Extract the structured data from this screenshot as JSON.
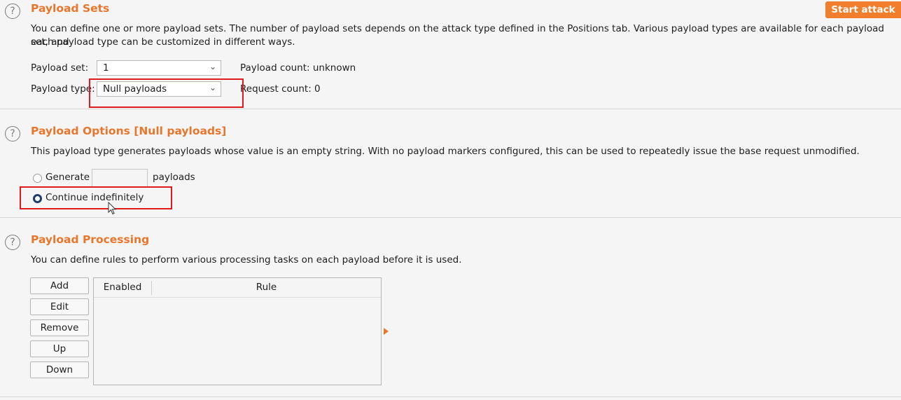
{
  "payload_sets": {
    "title": "Payload Sets",
    "start_attack": "Start attack",
    "desc_line1": "You can define one or more payload sets. The number of payload sets depends on the attack type defined in the Positions tab. Various payload types are available for each payload set, and",
    "desc_line2": "each payload type can be customized in different ways.",
    "set_label": "Payload set:",
    "set_value": "1",
    "type_label": "Payload type:",
    "type_value": "Null payloads",
    "payload_count": "Payload count: unknown",
    "request_count": "Request count: 0"
  },
  "payload_options": {
    "title": "Payload Options [Null payloads]",
    "desc": "This payload type generates payloads whose value is an empty string. With no payload markers configured, this can be used to repeatedly issue the base request unmodified.",
    "generate_label": "Generate",
    "generate_value": "",
    "payloads_suffix": "payloads",
    "continue_label": "Continue indefinitely",
    "selected_option": "continue"
  },
  "payload_processing": {
    "title": "Payload Processing",
    "desc": "You can define rules to perform various processing tasks on each payload before it is used.",
    "buttons": [
      "Add",
      "Edit",
      "Remove",
      "Up",
      "Down"
    ],
    "columns": [
      "Enabled",
      "Rule"
    ],
    "rows": []
  },
  "colors": {
    "accent": "#e8762c",
    "highlight": "#e01b1b"
  },
  "icons": [
    "help-icon",
    "chevron-down-icon",
    "mouse-cursor-icon",
    "expand-arrow-icon"
  ]
}
